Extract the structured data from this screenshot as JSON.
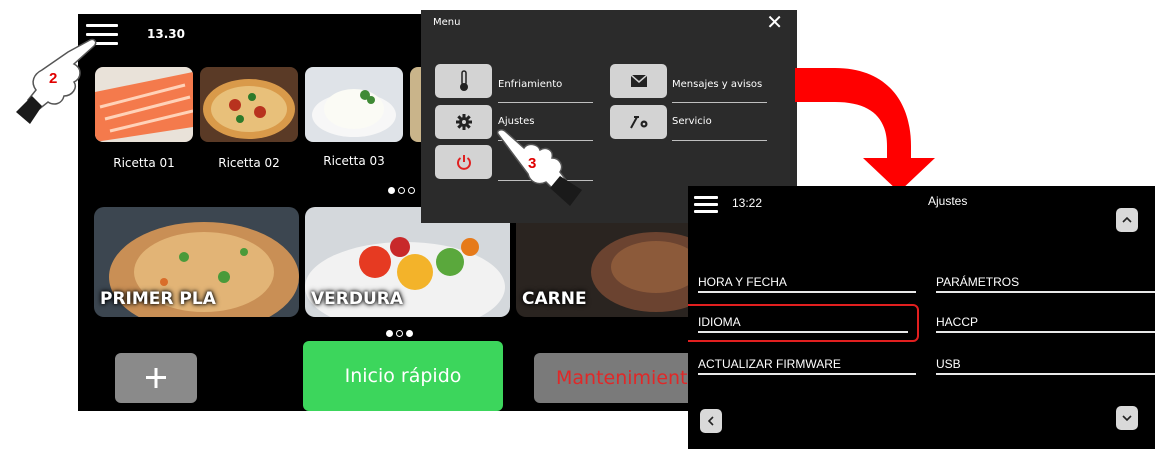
{
  "home": {
    "time": "13.30",
    "recipes": [
      {
        "label": "Ricetta 01",
        "image": "salmon-photo"
      },
      {
        "label": "Ricetta 02",
        "image": "pizza-photo"
      },
      {
        "label": "Ricetta 03",
        "image": "rice-photo"
      }
    ],
    "categories": [
      {
        "label": "PRIMER PLA",
        "image": "rice-dish-photo"
      },
      {
        "label": "VERDURA",
        "image": "vegetables-photo"
      },
      {
        "label": "CARNE",
        "image": "meat-photo"
      }
    ],
    "quick_start_label": "Inicio rápido",
    "maintenance_label": "Mantenimiento",
    "add_icon": "plus-icon"
  },
  "menu": {
    "title": "Menu",
    "close_icon": "close-icon",
    "items": [
      {
        "label": "Enfriamiento",
        "icon": "thermometer-icon"
      },
      {
        "label": "Mensajes y avisos",
        "icon": "envelope-icon"
      },
      {
        "label": "Ajustes",
        "icon": "gear-icon"
      },
      {
        "label": "Servicio",
        "icon": "tools-icon"
      },
      {
        "label": "",
        "icon": "power-icon"
      }
    ]
  },
  "ajustes": {
    "time": "13:22",
    "title": "Ajustes",
    "items": [
      {
        "label": "HORA Y FECHA"
      },
      {
        "label": "PARÁMETROS"
      },
      {
        "label": "IDIOMA",
        "highlighted": true
      },
      {
        "label": "HACCP"
      },
      {
        "label": "ACTUALIZAR FIRMWARE"
      },
      {
        "label": "USB"
      }
    ]
  },
  "steps": {
    "step2": "2",
    "step3": "3"
  },
  "colors": {
    "accent_green": "#3cd65c",
    "maintenance_text": "#e02828",
    "annotation_red": "#e21f1f",
    "arrow_red": "#ff0000"
  }
}
